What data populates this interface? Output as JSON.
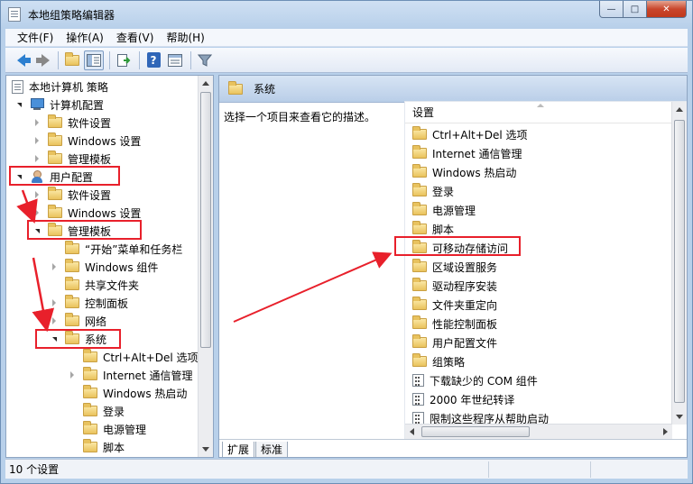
{
  "window": {
    "title": "本地组策略编辑器",
    "controls": {
      "minimize": "—",
      "maximize": "□",
      "close": "✕"
    }
  },
  "menu": [
    "文件(F)",
    "操作(A)",
    "查看(V)",
    "帮助(H)"
  ],
  "toolbar": {
    "icons": [
      "back-arrow-icon",
      "forward-arrow-icon",
      "up-folder-icon",
      "show-hide-tree-icon",
      "export-list-icon",
      "help-icon",
      "properties-icon",
      "filter-icon"
    ]
  },
  "tree": {
    "root": "本地计算机 策略",
    "computer_config": "计算机配置",
    "computer_children": [
      "软件设置",
      "Windows 设置",
      "管理模板"
    ],
    "user_config": "用户配置",
    "user_children": [
      "软件设置",
      "Windows 设置"
    ],
    "admin_templates": "管理模板",
    "admin_children": [
      "“开始”菜单和任务栏",
      "Windows 组件",
      "共享文件夹",
      "控制面板",
      "网络"
    ],
    "system": "系统",
    "system_children": [
      "Ctrl+Alt+Del 选项",
      "Internet 通信管理",
      "Windows 热启动",
      "登录",
      "电源管理",
      "脚本"
    ]
  },
  "right": {
    "header": "系统",
    "description": "选择一个项目来查看它的描述。",
    "column": "设置",
    "folders": [
      "Ctrl+Alt+Del 选项",
      "Internet 通信管理",
      "Windows 热启动",
      "登录",
      "电源管理",
      "脚本",
      "可移动存储访问",
      "区域设置服务",
      "驱动程序安装",
      "文件夹重定向",
      "性能控制面板",
      "用户配置文件",
      "组策略"
    ],
    "settings": [
      "下载缺少的 COM 组件",
      "2000 年世纪转译",
      "限制这些程序从帮助启动"
    ],
    "tabs": [
      "扩展",
      "标准"
    ]
  },
  "status": {
    "text": "10 个设置"
  },
  "colors": {
    "highlight": "#e8202b",
    "accent": "#2c7fd0"
  }
}
